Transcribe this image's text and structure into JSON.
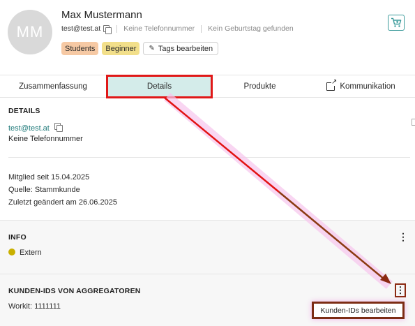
{
  "profile": {
    "initials": "MM",
    "name": "Max Mustermann",
    "email": "test@test.at",
    "phone": "Keine Telefonnummer",
    "birthday": "Kein Geburtstag gefunden"
  },
  "tags": {
    "items": [
      "Students",
      "Beginner"
    ],
    "edit_label": "Tags bearbeiten"
  },
  "tabs": {
    "summary": "Zusammenfassung",
    "details": "Details",
    "products": "Produkte",
    "communication": "Kommunikation",
    "active": "Details"
  },
  "details": {
    "title": "DETAILS",
    "email": "test@test.at",
    "phone": "Keine Telefonnummer",
    "member_since": "Mitglied seit 15.04.2025",
    "source": "Quelle: Stammkunde",
    "last_changed": "Zuletzt geändert am 26.06.2025"
  },
  "info": {
    "title": "INFO",
    "status": "Extern",
    "status_color": "#c9b000"
  },
  "aggregators": {
    "title": "KUNDEN-IDS VON AGGREGATOREN",
    "entry": "Workit: 1111111",
    "menu_item": "Kunden-IDs bearbeiten"
  },
  "colors": {
    "accent": "#1f7a7a",
    "active_tab_bg": "#d4ecea",
    "annotation_red": "#e01818",
    "annotation_brown": "#7c2c14"
  },
  "icons": [
    "copy-icon",
    "pencil-icon",
    "cart-icon",
    "external-link-icon",
    "kebab-menu-icon"
  ]
}
